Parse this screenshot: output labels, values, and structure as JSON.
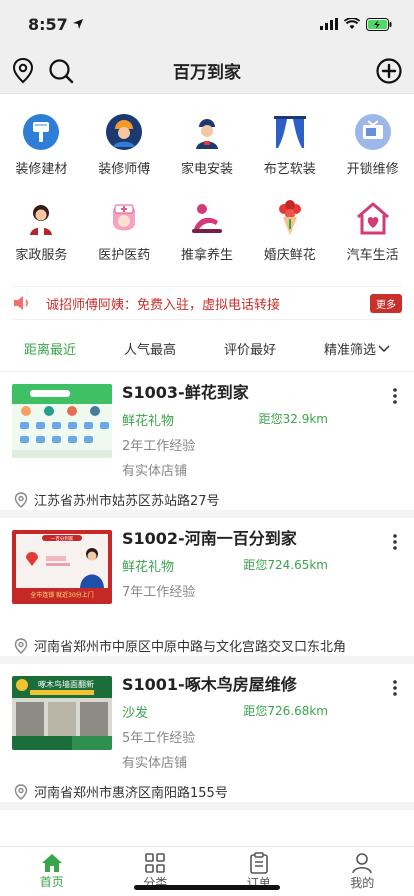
{
  "status": {
    "time": "8:57"
  },
  "header": {
    "title": "百万到家"
  },
  "categories": [
    {
      "label": "装修建材",
      "icon": "brush-icon",
      "color": "#2e7dd7"
    },
    {
      "label": "装修师傅",
      "icon": "worker-icon",
      "color": "#1c3a72"
    },
    {
      "label": "家电安装",
      "icon": "technician-icon",
      "color": "#1c3a72"
    },
    {
      "label": "布艺软装",
      "icon": "curtain-icon",
      "color": "#2e5fc8"
    },
    {
      "label": "开锁维修",
      "icon": "tv-icon",
      "color": "#6a8fd9"
    },
    {
      "label": "家政服务",
      "icon": "housekeeper-icon",
      "color": "#b8242c"
    },
    {
      "label": "医护医药",
      "icon": "nurse-icon",
      "color": "#e05a8a"
    },
    {
      "label": "推拿养生",
      "icon": "massage-icon",
      "color": "#d23a78"
    },
    {
      "label": "婚庆鲜花",
      "icon": "bouquet-icon",
      "color": "#c8302c"
    },
    {
      "label": "汽车生活",
      "icon": "heart-house-icon",
      "color": "#d23a78"
    }
  ],
  "notice": {
    "text": "诚招师傅阿姨：免费入驻，虚拟电话转接",
    "more": "更多"
  },
  "sort": [
    {
      "label": "距离最近",
      "active": true
    },
    {
      "label": "人气最高",
      "active": false
    },
    {
      "label": "评价最好",
      "active": false
    },
    {
      "label": "精准筛选",
      "active": false
    }
  ],
  "shops": [
    {
      "title": "S1003-鲜花到家",
      "category": "鲜花礼物",
      "distance": "距您32.9km",
      "experience": "2年工作经验",
      "store": "有实体店铺",
      "address": "江苏省苏州市姑苏区苏站路27号",
      "thumb": "app-screenshot"
    },
    {
      "title": "S1002-河南一百分到家",
      "category": "鲜花礼物",
      "distance": "距您724.65km",
      "experience": "7年工作经验",
      "store": "",
      "address": "河南省郑州市中原区中原中路与文化宫路交叉口东北角",
      "thumb": "poster",
      "thumb_top": "一百分到家",
      "thumb_bottom": "全市连锁 就近30分上门"
    },
    {
      "title": "S1001-啄木鸟房屋维修",
      "category": "沙发",
      "distance": "距您726.68km",
      "experience": "5年工作经验",
      "store": "有实体店铺",
      "address": "河南省郑州市惠济区南阳路155号",
      "thumb": "storefront",
      "thumb_sign": "啄木鸟墙面翻新"
    }
  ],
  "tabbar": [
    {
      "label": "首页",
      "active": true
    },
    {
      "label": "分类",
      "active": false
    },
    {
      "label": "订单",
      "active": false
    },
    {
      "label": "我的",
      "active": false
    }
  ],
  "colors": {
    "accent": "#3aa54a",
    "notice": "#c8302c"
  }
}
